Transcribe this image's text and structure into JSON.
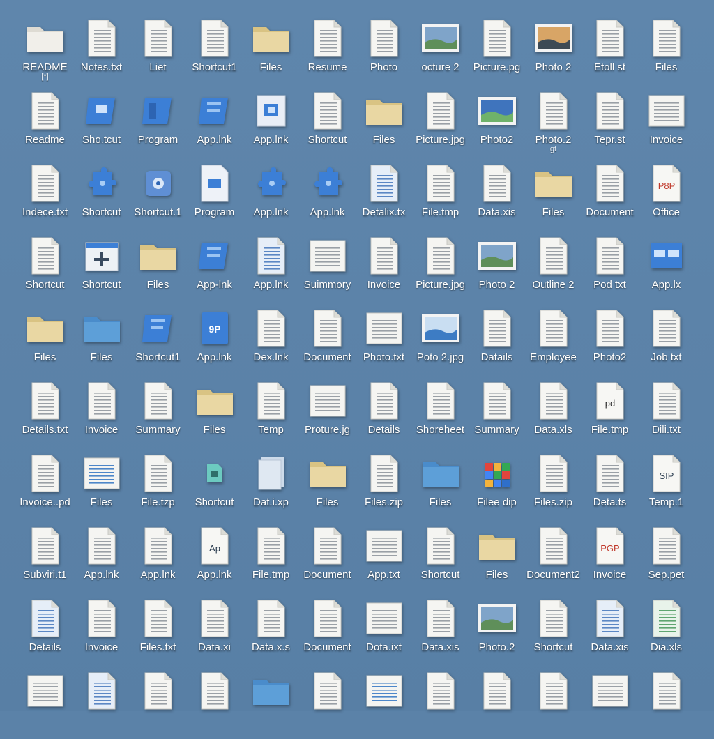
{
  "rows": [
    [
      {
        "label": "README",
        "sublabel": "[*]",
        "icon": "folder-plain-icon"
      },
      {
        "label": "Notes.txt",
        "icon": "document-icon"
      },
      {
        "label": "Liet",
        "icon": "document-icon"
      },
      {
        "label": "Shortcut1",
        "icon": "document-icon"
      },
      {
        "label": "Files",
        "icon": "folder-icon"
      },
      {
        "label": "Resume",
        "icon": "document-icon"
      },
      {
        "label": "Photo",
        "icon": "document-icon"
      },
      {
        "label": "octure 2",
        "icon": "landscape-photo-icon"
      },
      {
        "label": "Picture.pg",
        "icon": "document-icon"
      },
      {
        "label": "Photo 2",
        "icon": "sunset-photo-icon"
      },
      {
        "label": "Etoll st",
        "icon": "document-icon"
      },
      {
        "label": "Files",
        "icon": "document-icon"
      }
    ],
    [
      {
        "label": "Readme",
        "icon": "document-icon"
      },
      {
        "label": "Sho.tcut",
        "icon": "shortcut-tile-icon"
      },
      {
        "label": "Program",
        "icon": "program-icon"
      },
      {
        "label": "App.lnk",
        "icon": "app-link-icon"
      },
      {
        "label": "App.lnk",
        "icon": "app-window-icon"
      },
      {
        "label": "Shortcut",
        "icon": "document-icon"
      },
      {
        "label": "Files",
        "icon": "folder-icon"
      },
      {
        "label": "Picture.jpg",
        "icon": "document-icon"
      },
      {
        "label": "Photo2",
        "icon": "photo-icon"
      },
      {
        "label": "Photo.2",
        "sublabel": "gt",
        "icon": "document-icon"
      },
      {
        "label": "Tepr.st",
        "icon": "document-icon"
      },
      {
        "label": "Invoice",
        "icon": "document-wide-icon"
      }
    ],
    [
      {
        "label": "Indece.txt",
        "icon": "document-icon"
      },
      {
        "label": "Shortcut",
        "icon": "shortcut-puzzle-icon"
      },
      {
        "label": "Shortcut.1",
        "icon": "settings-app-icon"
      },
      {
        "label": "Program",
        "icon": "program-doc-icon"
      },
      {
        "label": "App.lnk",
        "icon": "puzzle-icon"
      },
      {
        "label": "App.lnk",
        "icon": "puzzle-icon"
      },
      {
        "label": "Detalix.tx",
        "icon": "blue-document-icon"
      },
      {
        "label": "File.tmp",
        "icon": "document-icon"
      },
      {
        "label": "Data.xis",
        "icon": "document-icon"
      },
      {
        "label": "Files",
        "icon": "folder-icon"
      },
      {
        "label": "Document",
        "icon": "document-icon"
      },
      {
        "label": "Office",
        "icon": "office-doc-icon",
        "badge": "P8P"
      }
    ],
    [
      {
        "label": "Shortcut",
        "icon": "document-icon"
      },
      {
        "label": "Shortcut",
        "icon": "add-folder-icon"
      },
      {
        "label": "Files",
        "icon": "folder-icon"
      },
      {
        "label": "App-lnk",
        "icon": "app-link-icon"
      },
      {
        "label": "App.lnk",
        "icon": "blue-document-icon"
      },
      {
        "label": "Suimmory",
        "icon": "document-wide-icon"
      },
      {
        "label": "Invoice",
        "icon": "document-icon"
      },
      {
        "label": "Picture.jpg",
        "icon": "document-icon"
      },
      {
        "label": "Photo 2",
        "icon": "landscape-photo-icon"
      },
      {
        "label": "Outline 2",
        "icon": "document-icon"
      },
      {
        "label": "Pod txt",
        "icon": "document-icon"
      },
      {
        "label": "App.lx",
        "icon": "app-window-blue-icon"
      }
    ],
    [
      {
        "label": "Files",
        "icon": "folder-icon"
      },
      {
        "label": "Files",
        "icon": "folder-blue-icon"
      },
      {
        "label": "Shortcut1",
        "icon": "app-link-icon"
      },
      {
        "label": "App.lnk",
        "icon": "sp-badge-icon",
        "badge": "9P"
      },
      {
        "label": "Dex.lnk",
        "icon": "document-icon"
      },
      {
        "label": "Document",
        "icon": "document-icon"
      },
      {
        "label": "Photo.txt",
        "icon": "document-wide-icon"
      },
      {
        "label": "Poto 2.jpg",
        "icon": "wave-photo-icon"
      },
      {
        "label": "Datails",
        "icon": "document-icon"
      },
      {
        "label": "Employee",
        "icon": "document-icon"
      },
      {
        "label": "Photo2",
        "icon": "document-icon"
      },
      {
        "label": "Job txt",
        "icon": "document-icon"
      }
    ],
    [
      {
        "label": "Details.txt",
        "icon": "document-icon"
      },
      {
        "label": "Invoice",
        "icon": "document-icon"
      },
      {
        "label": "Summary",
        "icon": "document-icon"
      },
      {
        "label": "Files",
        "icon": "folder-icon"
      },
      {
        "label": "Temp",
        "icon": "document-icon"
      },
      {
        "label": "Proture.jg",
        "icon": "document-wide-icon"
      },
      {
        "label": "Details",
        "icon": "document-icon"
      },
      {
        "label": "Shoreheet",
        "icon": "document-icon"
      },
      {
        "label": "Summary",
        "icon": "document-icon"
      },
      {
        "label": "Data.xls",
        "icon": "document-icon"
      },
      {
        "label": "File.tmp",
        "icon": "pdf-doc-icon",
        "badge": "pd"
      },
      {
        "label": "Dili.txt",
        "icon": "document-icon"
      }
    ],
    [
      {
        "label": "Invoice..pd",
        "icon": "document-icon"
      },
      {
        "label": "Files",
        "icon": "blue-lines-icon"
      },
      {
        "label": "File.tzp",
        "icon": "document-icon"
      },
      {
        "label": "Shortcut",
        "icon": "teal-app-icon"
      },
      {
        "label": "Dat.i.xp",
        "icon": "stack-icon"
      },
      {
        "label": "Files",
        "icon": "folder-icon"
      },
      {
        "label": "Files.zip",
        "icon": "document-icon"
      },
      {
        "label": "Files",
        "icon": "folder-blue-icon"
      },
      {
        "label": "Filee dip",
        "icon": "colorful-cube-icon"
      },
      {
        "label": "Files.zip",
        "icon": "document-icon"
      },
      {
        "label": "Deta.ts",
        "icon": "document-icon"
      },
      {
        "label": "Temp.1",
        "icon": "sip-doc-icon",
        "badge": "SIP"
      }
    ],
    [
      {
        "label": "Subviri.t1",
        "icon": "document-icon"
      },
      {
        "label": "App.lnk",
        "icon": "document-icon"
      },
      {
        "label": "App.lnk",
        "icon": "document-icon"
      },
      {
        "label": "App.lnk",
        "icon": "ap-doc-icon",
        "badge": "Ap"
      },
      {
        "label": "File.tmp",
        "icon": "document-icon"
      },
      {
        "label": "Document",
        "icon": "document-icon"
      },
      {
        "label": "App.txt",
        "icon": "document-wide-icon"
      },
      {
        "label": "Shortcut",
        "icon": "document-icon"
      },
      {
        "label": "Files",
        "icon": "folder-icon"
      },
      {
        "label": "Document2",
        "icon": "document-icon"
      },
      {
        "label": "Invoice",
        "icon": "pgp-doc-icon",
        "badge": "PGP"
      },
      {
        "label": "Sep.pet",
        "icon": "document-icon"
      }
    ],
    [
      {
        "label": "Details",
        "icon": "blue-document-icon"
      },
      {
        "label": "Invoice",
        "icon": "document-icon"
      },
      {
        "label": "Files.txt",
        "icon": "document-icon"
      },
      {
        "label": "Data.xi",
        "icon": "document-icon"
      },
      {
        "label": "Data.x.s",
        "icon": "document-icon"
      },
      {
        "label": "Document",
        "icon": "document-icon"
      },
      {
        "label": "Dota.ixt",
        "icon": "document-wide-icon"
      },
      {
        "label": "Data.xis",
        "icon": "document-icon"
      },
      {
        "label": "Photo.2",
        "icon": "landscape-photo-icon"
      },
      {
        "label": "Shortcut",
        "icon": "document-icon"
      },
      {
        "label": "Data.xis",
        "icon": "blue-document-icon"
      },
      {
        "label": "Dia.xls",
        "icon": "green-doc-icon"
      }
    ],
    [
      {
        "label": "",
        "icon": "document-wide-icon"
      },
      {
        "label": "",
        "icon": "blue-document-icon"
      },
      {
        "label": "",
        "icon": "document-icon"
      },
      {
        "label": "",
        "icon": "document-icon"
      },
      {
        "label": "",
        "icon": "folder-blue-icon"
      },
      {
        "label": "",
        "icon": "document-icon"
      },
      {
        "label": "",
        "icon": "blue-lines-icon"
      },
      {
        "label": "",
        "icon": "document-icon"
      },
      {
        "label": "",
        "icon": "document-icon"
      },
      {
        "label": "",
        "icon": "document-icon"
      },
      {
        "label": "",
        "icon": "document-wide-icon"
      },
      {
        "label": "",
        "icon": "document-icon"
      }
    ]
  ],
  "colors": {
    "desktop": "#5b82a8",
    "folder": "#e9d7a3",
    "folder_blue": "#5d9fd8",
    "accent_blue": "#3c7fd6",
    "teal": "#6ccac0"
  }
}
